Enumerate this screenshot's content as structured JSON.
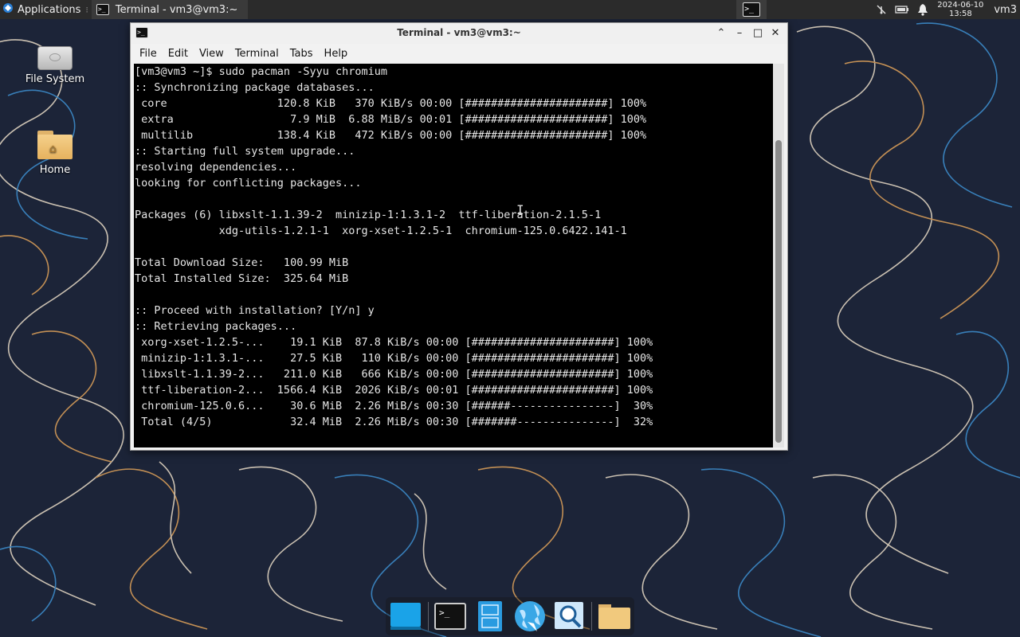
{
  "top_panel": {
    "applications_label": "Applications",
    "taskbar_item_label": "Terminal - vm3@vm3:~",
    "clock_date": "2024-06-10",
    "clock_time": "13:58",
    "user_label": "vm3"
  },
  "desktop": {
    "icons": [
      {
        "label": "File System"
      },
      {
        "label": "Home"
      }
    ]
  },
  "window": {
    "title": "Terminal - vm3@vm3:~",
    "menu": [
      "File",
      "Edit",
      "View",
      "Terminal",
      "Tabs",
      "Help"
    ]
  },
  "terminal": {
    "lines": [
      "[vm3@vm3 ~]$ sudo pacman -Syyu chromium",
      ":: Synchronizing package databases...",
      " core                 120.8 KiB   370 KiB/s 00:00 [######################] 100%",
      " extra                  7.9 MiB  6.88 MiB/s 00:01 [######################] 100%",
      " multilib             138.4 KiB   472 KiB/s 00:00 [######################] 100%",
      ":: Starting full system upgrade...",
      "resolving dependencies...",
      "looking for conflicting packages...",
      "",
      "Packages (6) libxslt-1.1.39-2  minizip-1:1.3.1-2  ttf-liberation-2.1.5-1",
      "             xdg-utils-1.2.1-1  xorg-xset-1.2.5-1  chromium-125.0.6422.141-1",
      "",
      "Total Download Size:   100.99 MiB",
      "Total Installed Size:  325.64 MiB",
      "",
      ":: Proceed with installation? [Y/n] y",
      ":: Retrieving packages...",
      " xorg-xset-1.2.5-...    19.1 KiB  87.8 KiB/s 00:00 [######################] 100%",
      " minizip-1:1.3.1-...    27.5 KiB   110 KiB/s 00:00 [######################] 100%",
      " libxslt-1.1.39-2...   211.0 KiB   666 KiB/s 00:00 [######################] 100%",
      " ttf-liberation-2...  1566.4 KiB  2026 KiB/s 00:01 [######################] 100%",
      " chromium-125.0.6...    30.6 MiB  2.26 MiB/s 00:30 [######----------------]  30%",
      " Total (4/5)            32.4 MiB  2.26 MiB/s 00:30 [#######---------------]  32%"
    ]
  },
  "icons": {
    "applications": "xfce-logo-icon",
    "terminal": "terminal-icon",
    "network": "network-disconnected-icon",
    "battery": "battery-icon",
    "notifications": "bell-icon"
  }
}
